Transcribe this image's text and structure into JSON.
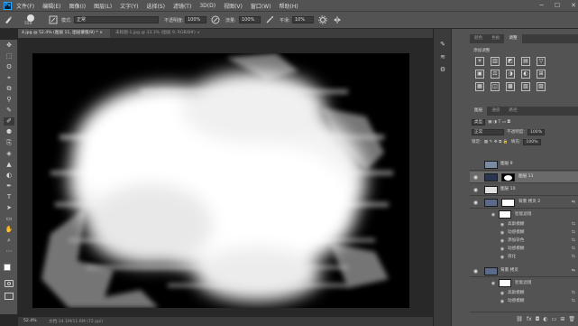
{
  "app": {
    "logo": "Ps"
  },
  "menu": [
    "文件(F)",
    "编辑(E)",
    "图像(I)",
    "图层(L)",
    "文字(Y)",
    "选择(S)",
    "滤镜(T)",
    "3D(D)",
    "视图(V)",
    "窗口(W)",
    "帮助(H)"
  ],
  "window_controls": [
    "─",
    "☐",
    "✕"
  ],
  "options": {
    "brush_size": "554",
    "mode_label": "模式:",
    "mode_value": "正常",
    "opacity_label": "不透明度:",
    "opacity_value": "100%",
    "flow_label": "流量:",
    "flow_value": "100%",
    "smooth_label": "平滑:",
    "smooth_value": "10%"
  },
  "tabs": [
    {
      "label": "4.jpg @ 52.4% (图层 11, 图层蒙版/8) * ×",
      "active": true
    },
    {
      "label": "未标题-1.jpg @ 33.3% (图层 9, RGB/8#) ×",
      "active": false
    }
  ],
  "tools": [
    "✥",
    "⬚",
    "ʘ",
    "⌖",
    "⧉",
    "⚲",
    "✎",
    "✐",
    "⚈",
    "⎘",
    "◈",
    "▲",
    "◐",
    "✒",
    "T",
    "➤",
    "▭",
    "✋",
    "⌕",
    "⋯"
  ],
  "status": {
    "zoom": "52.4%",
    "doc": "文档:14.1M/11.6M (72 ppi)"
  },
  "strip_icons": [
    "✎",
    "≋",
    "⚙"
  ],
  "panel_tabs_top": [
    {
      "label": "颜色",
      "active": false
    },
    {
      "label": "色板",
      "active": false
    },
    {
      "label": "调整",
      "active": true
    }
  ],
  "adjust_title": "添加调整",
  "adjust_icons": [
    "☀",
    "▥",
    "◩",
    "▤",
    "▽",
    "▣",
    "⚖",
    "◑",
    "◐",
    "⊞",
    "▦",
    "◫",
    "▩",
    "▧",
    "▨"
  ],
  "panel_tabs_layers": [
    {
      "label": "图层",
      "active": true
    },
    {
      "label": "通道",
      "active": false
    },
    {
      "label": "路径",
      "active": false
    }
  ],
  "layers_ctrl": {
    "kind": "类型",
    "blend": "正常",
    "opacity_label": "不透明度:",
    "opacity": "100%",
    "lock_label": "锁定:",
    "fill_label": "填充:",
    "fill": "100%"
  },
  "layers": [
    {
      "name": "图层 9",
      "visible": true,
      "selected": false,
      "thumb": "#7a8aa0"
    },
    {
      "name": "图层 11",
      "visible": true,
      "selected": true,
      "thumb": "#2a3550"
    },
    {
      "name": "图层 10",
      "visible": true,
      "selected": false,
      "thumb": "#e0e0e0"
    },
    {
      "name": "背景 拷贝 2",
      "visible": true,
      "selected": false,
      "thumb": "#5a6a88"
    },
    {
      "name": "背景 拷贝",
      "visible": true,
      "selected": false,
      "thumb": "#5a6a88"
    }
  ],
  "filter_groups": [
    {
      "label": "智能滤镜",
      "items": [
        "高斯模糊",
        "动感模糊",
        "添加杂色",
        "动感模糊",
        "液化"
      ]
    },
    {
      "label": "智能滤镜",
      "items": [
        "高斯模糊",
        "动感模糊"
      ]
    }
  ],
  "layer_icons": {
    "eye": "◉",
    "fx": "⇋",
    "adj": "⇆"
  },
  "footer_icons": [
    "⛓",
    "fx",
    "◘",
    "◐",
    "▭",
    "⊞",
    "🗑"
  ]
}
